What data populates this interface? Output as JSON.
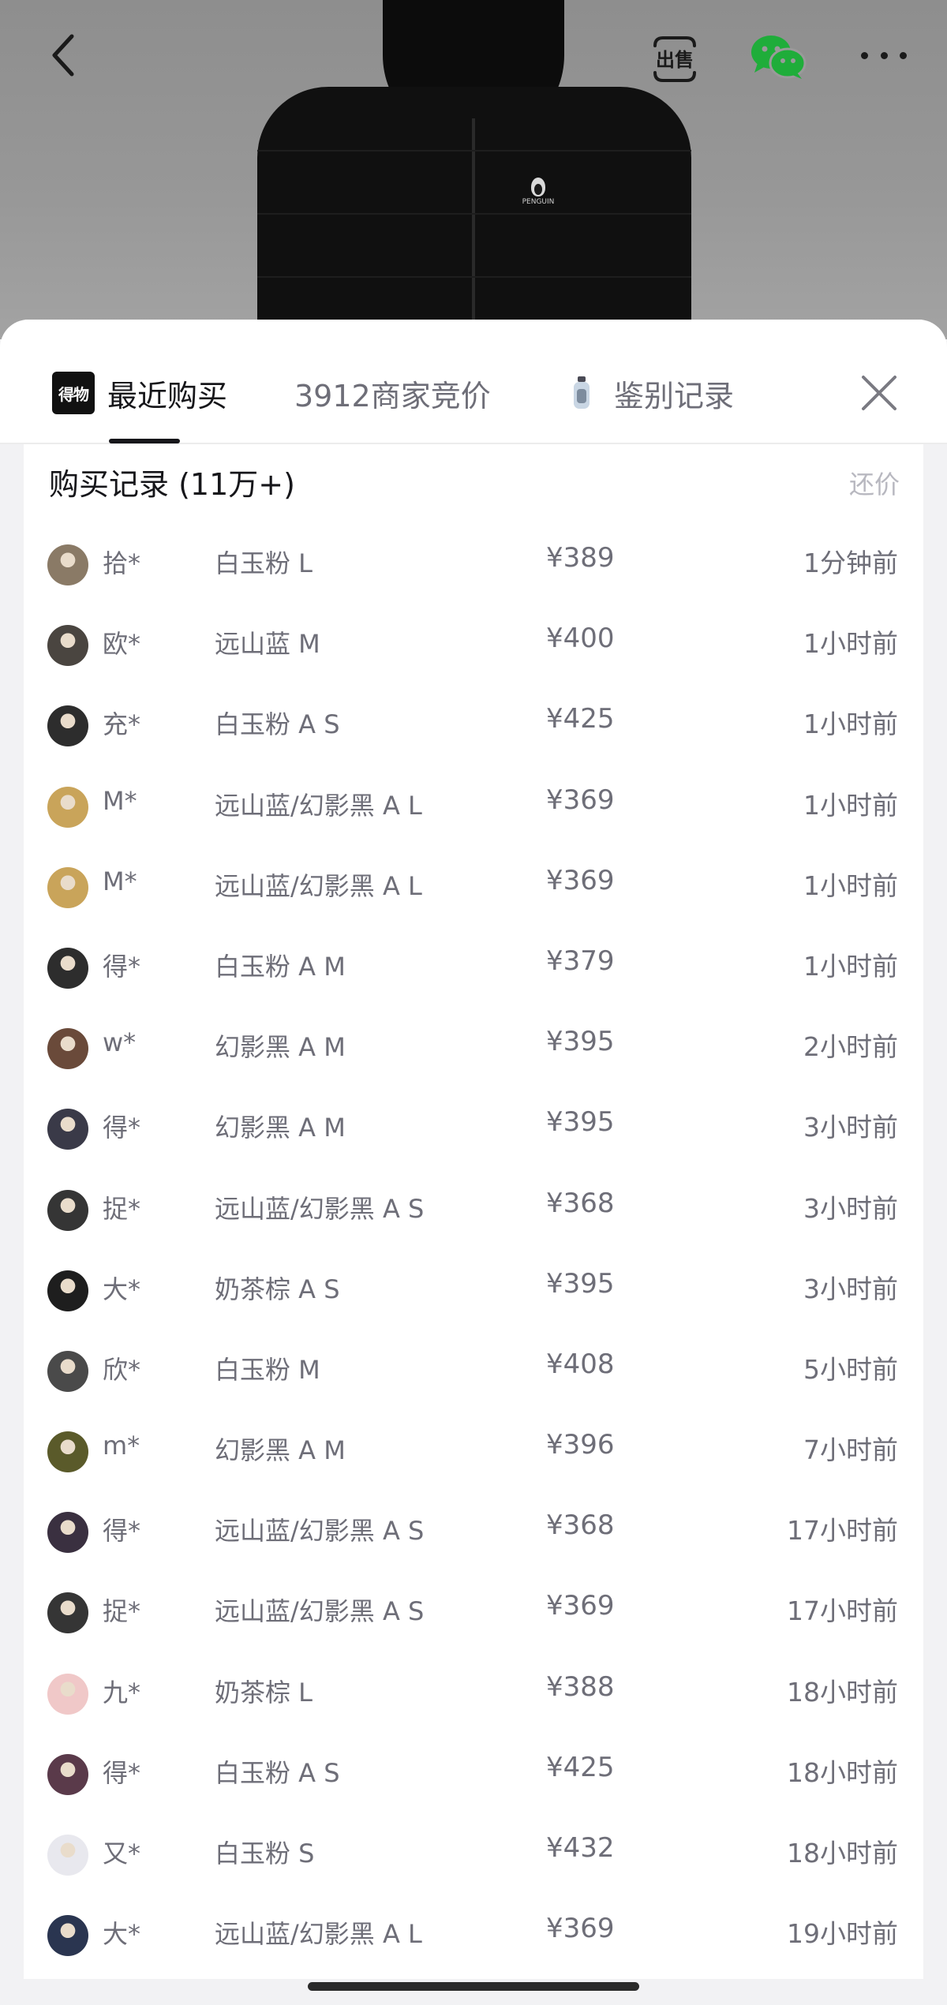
{
  "hero": {
    "brand_mark": "PENGUIN",
    "nav": {
      "back_icon": "chevron-left-icon",
      "sell_label": "出售",
      "share_icon": "wechat-icon",
      "more_icon": "more-horizontal-icon"
    }
  },
  "tabs": [
    {
      "label": "最近购买",
      "active": true,
      "icon": "dewu-logo-icon",
      "icon_text": "得物"
    },
    {
      "label": "3912商家竞价",
      "active": false
    },
    {
      "label": "鉴别记录",
      "active": false,
      "icon": "bottle-icon"
    }
  ],
  "close_icon": "close-icon",
  "records": {
    "title": "购买记录 (11万+)",
    "action": "还价",
    "rows": [
      {
        "user": "拾*",
        "spec": "白玉粉 L",
        "price": "¥389",
        "time": "1分钟前",
        "avatar_color": "#8a7a66"
      },
      {
        "user": "欧*",
        "spec": "远山蓝 M",
        "price": "¥400",
        "time": "1小时前",
        "avatar_color": "#4a4540"
      },
      {
        "user": "充*",
        "spec": "白玉粉 A S",
        "price": "¥425",
        "time": "1小时前",
        "avatar_color": "#2d2d2d"
      },
      {
        "user": "M*",
        "spec": "远山蓝/幻影黑 A L",
        "price": "¥369",
        "time": "1小时前",
        "avatar_color": "#c9a45a"
      },
      {
        "user": "M*",
        "spec": "远山蓝/幻影黑 A L",
        "price": "¥369",
        "time": "1小时前",
        "avatar_color": "#c9a45a"
      },
      {
        "user": "得*",
        "spec": "白玉粉 A M",
        "price": "¥379",
        "time": "1小时前",
        "avatar_color": "#2d2d2d"
      },
      {
        "user": "w*",
        "spec": "幻影黑 A M",
        "price": "¥395",
        "time": "2小时前",
        "avatar_color": "#6a4a3a"
      },
      {
        "user": "得*",
        "spec": "幻影黑 A M",
        "price": "¥395",
        "time": "3小时前",
        "avatar_color": "#3a3a48"
      },
      {
        "user": "捉*",
        "spec": "远山蓝/幻影黑 A S",
        "price": "¥368",
        "time": "3小时前",
        "avatar_color": "#353535"
      },
      {
        "user": "大*",
        "spec": "奶茶棕 A S",
        "price": "¥395",
        "time": "3小时前",
        "avatar_color": "#1e1e1e"
      },
      {
        "user": "欣*",
        "spec": "白玉粉 M",
        "price": "¥408",
        "time": "5小时前",
        "avatar_color": "#4a4a4a"
      },
      {
        "user": "m*",
        "spec": "幻影黑 A M",
        "price": "¥396",
        "time": "7小时前",
        "avatar_color": "#5a5a2a"
      },
      {
        "user": "得*",
        "spec": "远山蓝/幻影黑 A S",
        "price": "¥368",
        "time": "17小时前",
        "avatar_color": "#3a3040"
      },
      {
        "user": "捉*",
        "spec": "远山蓝/幻影黑 A S",
        "price": "¥369",
        "time": "17小时前",
        "avatar_color": "#353535"
      },
      {
        "user": "九*",
        "spec": "奶茶棕 L",
        "price": "¥388",
        "time": "18小时前",
        "avatar_color": "#f0c8c8"
      },
      {
        "user": "得*",
        "spec": "白玉粉 A S",
        "price": "¥425",
        "time": "18小时前",
        "avatar_color": "#5a3a4a"
      },
      {
        "user": "又*",
        "spec": "白玉粉 S",
        "price": "¥432",
        "time": "18小时前",
        "avatar_color": "#e8e8ee"
      },
      {
        "user": "大*",
        "spec": "远山蓝/幻影黑 A L",
        "price": "¥369",
        "time": "19小时前",
        "avatar_color": "#2a3550"
      }
    ]
  }
}
